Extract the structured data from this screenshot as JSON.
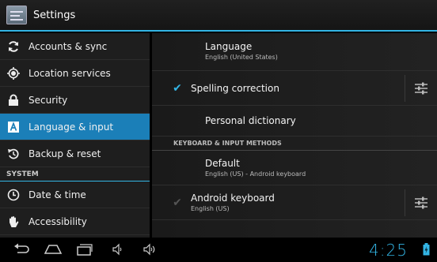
{
  "app": {
    "title": "Settings"
  },
  "sidebar": {
    "items": [
      {
        "label": "Accounts & sync",
        "icon": "sync-icon"
      },
      {
        "label": "Location services",
        "icon": "location-icon"
      },
      {
        "label": "Security",
        "icon": "lock-icon"
      },
      {
        "label": "Language & input",
        "icon": "language-icon",
        "active": true
      },
      {
        "label": "Backup & reset",
        "icon": "backup-icon"
      }
    ],
    "section_header": "SYSTEM",
    "system_items": [
      {
        "label": "Date & time",
        "icon": "clock-icon"
      },
      {
        "label": "Accessibility",
        "icon": "hand-icon"
      }
    ]
  },
  "pane": {
    "language": {
      "title": "Language",
      "summary": "English (United States)"
    },
    "spelling": {
      "title": "Spelling correction",
      "checked": true
    },
    "dictionary": {
      "title": "Personal dictionary"
    },
    "category": "KEYBOARD & INPUT METHODS",
    "default_ime": {
      "title": "Default",
      "summary": "English (US) - Android keyboard"
    },
    "android_keyboard": {
      "title": "Android keyboard",
      "summary": "English (US)",
      "checked": true
    }
  },
  "statusbar": {
    "time": "4:25"
  },
  "colors": {
    "accent": "#33b5e5",
    "selected": "#1b7fb8"
  }
}
